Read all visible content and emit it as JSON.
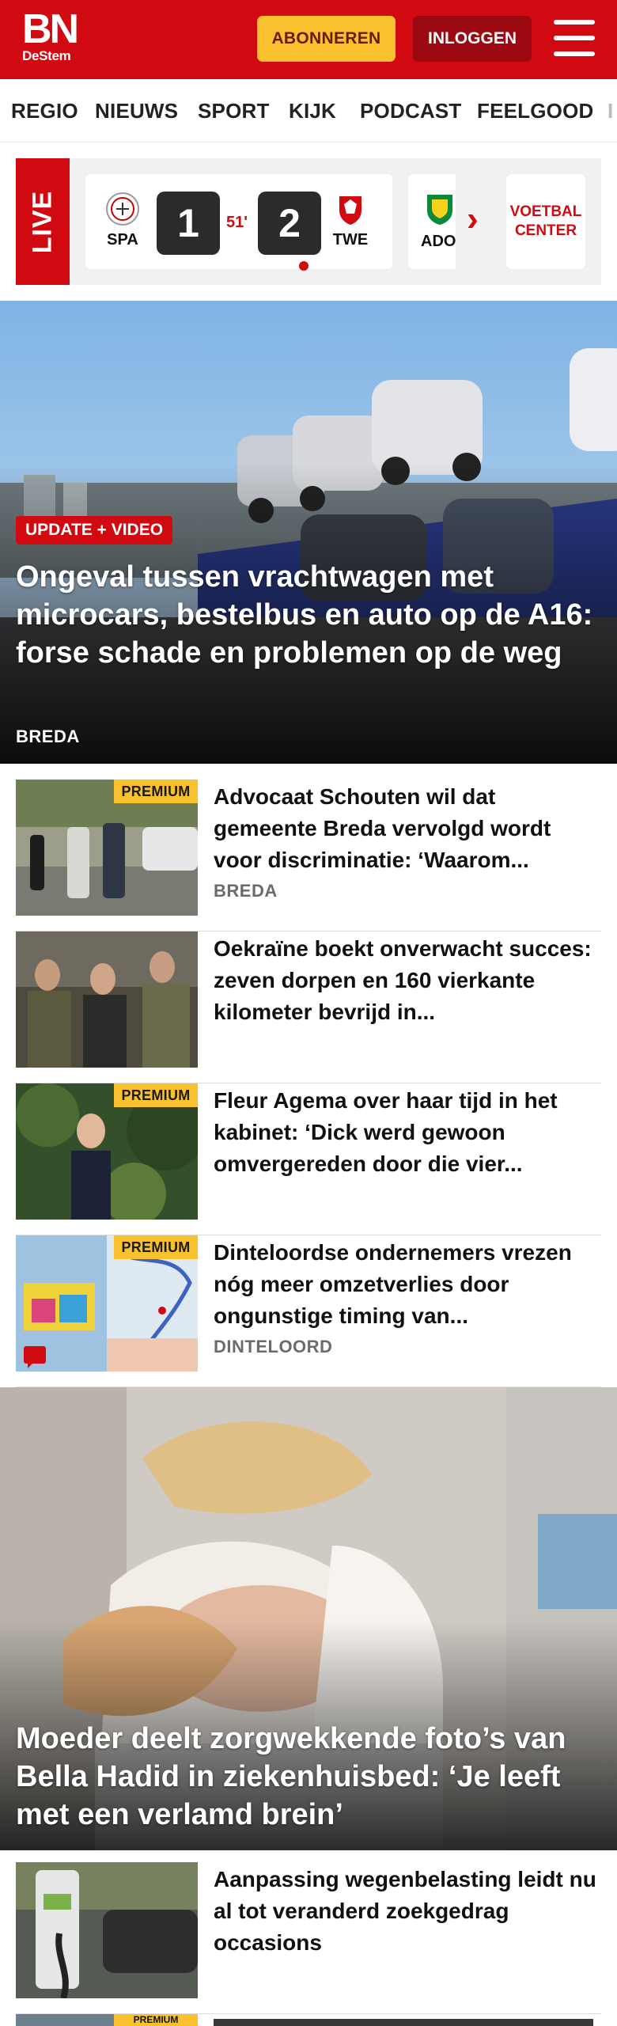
{
  "header": {
    "logo_main": "BN",
    "logo_sub": "DeStem",
    "subscribe_label": "ABONNEREN",
    "login_label": "INLOGGEN",
    "brand_color": "#d10a11",
    "subscribe_color": "#f9c12e"
  },
  "nav": {
    "items": [
      "REGIO",
      "NIEUWS",
      "SPORT",
      "KIJK",
      "PODCAST",
      "FEELGOOD",
      "I"
    ]
  },
  "ticker": {
    "live_label": "LIVE",
    "match": {
      "home": "SPA",
      "away": "TWE",
      "home_score": "1",
      "away_score": "2",
      "minute": "51'"
    },
    "next_match_home": "ADO",
    "center_label_1": "VOETBAL",
    "center_label_2": "CENTER"
  },
  "hero": {
    "tag": "UPDATE + VIDEO",
    "title": "Ongeval tussen vrachtwagen met microcars, bestelbus en auto op de A16: forse schade en problemen op de weg",
    "location": "BREDA"
  },
  "articles": [
    {
      "title": "Advocaat Schouten wil dat gemeente Breda vervolgd wordt voor discriminatie: ‘Waarom...",
      "location": "BREDA",
      "premium": "PREMIUM"
    },
    {
      "title": "Oekraïne boekt onverwacht succes: zeven dorpen en 160 vierkante kilometer bevrijd in...",
      "location": "",
      "premium": ""
    },
    {
      "title": "Fleur Agema over haar tijd in het kabinet: ‘Dick werd gewoon omvergereden door die vier...",
      "location": "",
      "premium": "PREMIUM"
    },
    {
      "title": "Dinteloordse ondernemers vrezen nóg meer omzetverlies door ongunstige timing van...",
      "location": "DINTELOORD",
      "premium": "PREMIUM"
    }
  ],
  "hero2": {
    "title": "Moeder deelt zorgwekkende foto’s van Bella Hadid in ziekenhuisbed: ‘Je leeft met een verlamd brein’"
  },
  "articles2": [
    {
      "title": "Aanpassing wegenbelasting leidt nu al tot veranderd zoekgedrag occasions",
      "location": ""
    }
  ],
  "partial_premium": "PREMIUM"
}
